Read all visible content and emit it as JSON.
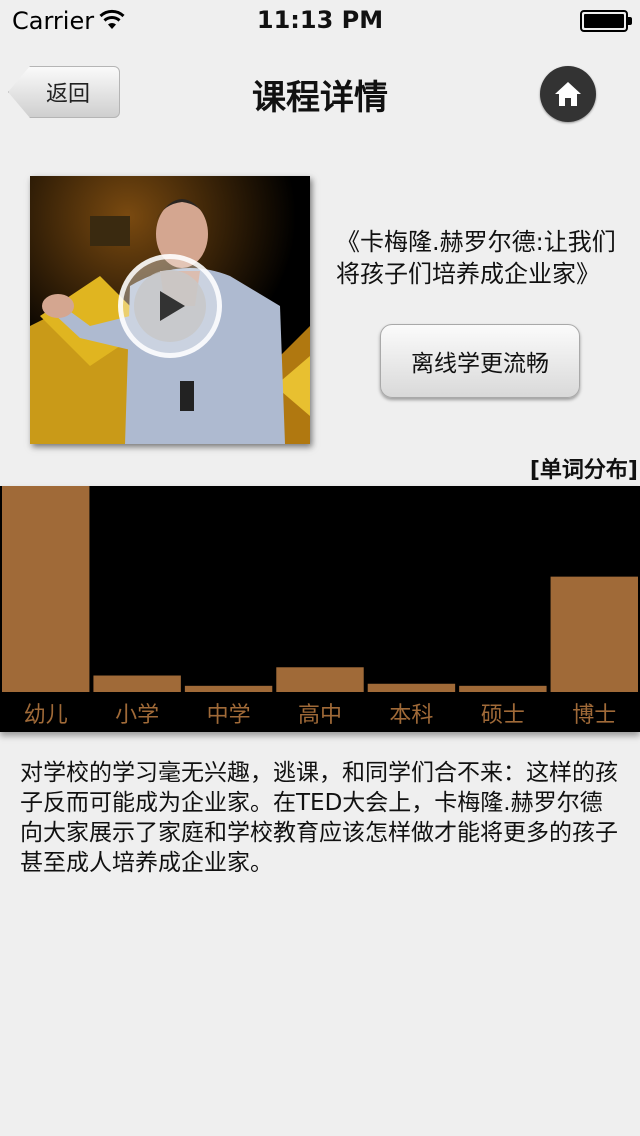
{
  "status_bar": {
    "carrier": "Carrier",
    "time": "11:13 PM"
  },
  "nav": {
    "back_label": "返回",
    "title": "课程详情",
    "home_icon": "home-icon"
  },
  "course": {
    "title": "《卡梅隆.赫罗尔德:让我们将孩子们培养成企业家》",
    "offline_button": "离线学更流畅",
    "play_icon": "play-icon"
  },
  "chart_label": "[单词分布]",
  "chart_data": {
    "type": "bar",
    "categories": [
      "幼儿",
      "小学",
      "中学",
      "高中",
      "本科",
      "硕士",
      "博士"
    ],
    "values": [
      100,
      8,
      3,
      12,
      4,
      3,
      56
    ],
    "ylim": [
      0,
      100
    ],
    "bar_color": "#a06a38",
    "label_color": "#a06a38",
    "background": "#000000"
  },
  "description": "对学校的学习毫无兴趣，逃课，和同学们合不来：这样的孩子反而可能成为企业家。在TED大会上，卡梅隆.赫罗尔德向大家展示了家庭和学校教育应该怎样做才能将更多的孩子甚至成人培养成企业家。"
}
